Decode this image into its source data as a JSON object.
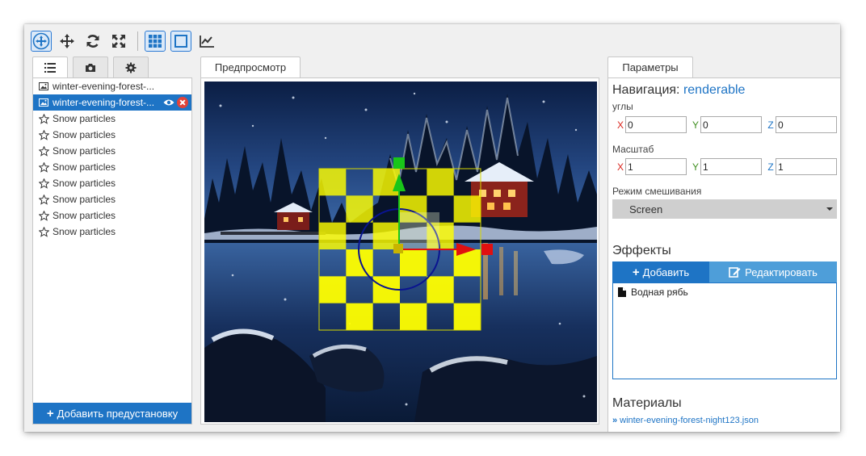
{
  "toolbar": {
    "buttons": [
      {
        "icon": "move-gizmo-icon",
        "active": true
      },
      {
        "icon": "pan-icon",
        "active": false
      },
      {
        "icon": "rotate-icon",
        "active": false
      },
      {
        "icon": "scale-icon",
        "active": false
      },
      {
        "icon": "grid-icon",
        "active": true
      },
      {
        "icon": "frame-icon",
        "active": true
      },
      {
        "icon": "chart-icon",
        "active": false
      }
    ]
  },
  "left": {
    "tabs": [
      {
        "icon": "list-icon",
        "active": true
      },
      {
        "icon": "camera-icon",
        "active": false
      },
      {
        "icon": "gear-icon",
        "active": false
      }
    ],
    "items": [
      {
        "label": "winter-evening-forest-...",
        "icon": "image-icon",
        "selected": false
      },
      {
        "label": "winter-evening-forest-...",
        "icon": "image-icon",
        "selected": true
      },
      {
        "label": "Snow particles",
        "icon": "star-icon",
        "selected": false
      },
      {
        "label": "Snow particles",
        "icon": "star-icon",
        "selected": false
      },
      {
        "label": "Snow particles",
        "icon": "star-icon",
        "selected": false
      },
      {
        "label": "Snow particles",
        "icon": "star-icon",
        "selected": false
      },
      {
        "label": "Snow particles",
        "icon": "star-icon",
        "selected": false
      },
      {
        "label": "Snow particles",
        "icon": "star-icon",
        "selected": false
      },
      {
        "label": "Snow particles",
        "icon": "star-icon",
        "selected": false
      },
      {
        "label": "Snow particles",
        "icon": "star-icon",
        "selected": false
      }
    ],
    "add_preset_label": "Добавить предустановку"
  },
  "center": {
    "tab_label": "Предпросмотр"
  },
  "right": {
    "tab_label": "Параметры",
    "nav_title": "Навигация:",
    "nav_target": "renderable",
    "angles_label": "углы",
    "angles": {
      "x": "0",
      "y": "0",
      "z": "0"
    },
    "scale_label": "Масштаб",
    "scale": {
      "x": "1",
      "y": "1",
      "z": "1"
    },
    "axis_x": "X",
    "axis_y": "Y",
    "axis_z": "Z",
    "blend_label": "Режим смешивания",
    "blend_value": "Screen",
    "effects_title": "Эффекты",
    "add_effect_label": "Добавить",
    "edit_effect_label": "Редактировать",
    "effects": [
      {
        "label": "Водная рябь"
      }
    ],
    "materials_title": "Материалы",
    "material_link": "winter-evening-forest-night123.json"
  },
  "colors": {
    "accent": "#1e74c5",
    "axis_x": "#d9241c",
    "axis_y": "#3f8f20",
    "axis_z": "#1e74c5",
    "checker": "#ffff00"
  }
}
